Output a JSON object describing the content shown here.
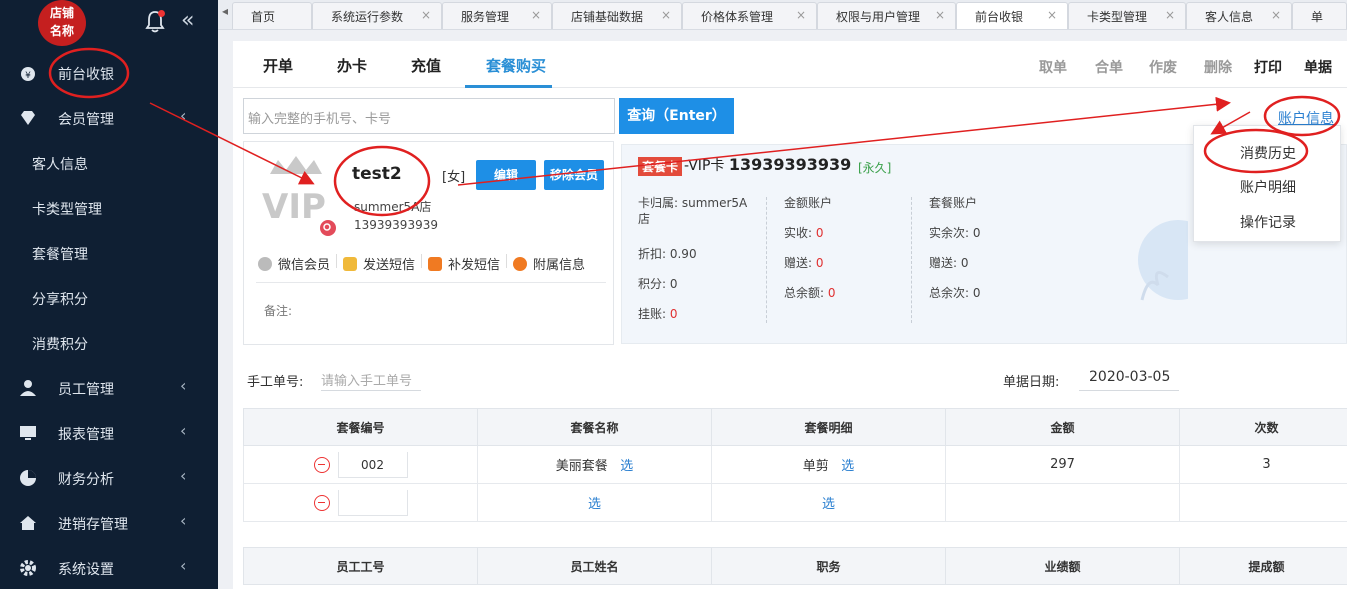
{
  "logo": {
    "line1": "店铺",
    "line2": "名称"
  },
  "sidebar": {
    "items": [
      {
        "label": "前台收银",
        "icon": "money-bag-icon"
      },
      {
        "label": "会员管理",
        "icon": "diamond-icon"
      },
      {
        "label": "客人信息"
      },
      {
        "label": "卡类型管理"
      },
      {
        "label": "套餐管理"
      },
      {
        "label": "分享积分"
      },
      {
        "label": "消费积分"
      },
      {
        "label": "员工管理",
        "icon": "user-icon"
      },
      {
        "label": "报表管理",
        "icon": "monitor-icon"
      },
      {
        "label": "财务分析",
        "icon": "pie-chart-icon"
      },
      {
        "label": "进销存管理",
        "icon": "home-icon"
      },
      {
        "label": "系统设置",
        "icon": "gear-icon"
      }
    ]
  },
  "tabs": [
    "首页",
    "系统运行参数",
    "服务管理",
    "店铺基础数据",
    "价格体系管理",
    "权限与用户管理",
    "前台收银",
    "卡类型管理",
    "客人信息",
    "单"
  ],
  "subtabs": [
    "开单",
    "办卡",
    "充值",
    "套餐购买"
  ],
  "actions": [
    "取单",
    "合单",
    "作废",
    "删除",
    "打印",
    "单据"
  ],
  "search": {
    "placeholder": "输入完整的手机号、卡号",
    "button": "查询（Enter）"
  },
  "account_link": "账户信息",
  "member": {
    "name": "test2",
    "gender": "[女]",
    "edit": "编辑",
    "remove": "移除会员",
    "store": "summer5A店",
    "phone": "13939393939",
    "links": [
      "微信会员",
      "发送短信",
      "补发短信",
      "附属信息"
    ],
    "note_label": "备注:"
  },
  "card": {
    "tag": "套餐卡",
    "title_prefix": "-VIP卡",
    "number": "13939393939",
    "validity": "[永久]",
    "col1": {
      "store": "卡归属: summer5A店",
      "discount": "折扣: 0.90",
      "points": "积分: 0",
      "debt_label": "挂账:",
      "debt": "0"
    },
    "col2": {
      "title": "金额账户",
      "paid_label": "实收:",
      "paid": "0",
      "gift_label": "赠送:",
      "gift": "0",
      "total_label": "总余额:",
      "total": "0"
    },
    "col3": {
      "title": "套餐账户",
      "paid": "实余次: 0",
      "gift": "赠送: 0",
      "total": "总余次: 0"
    }
  },
  "dropdown": [
    "消费历史",
    "账户明细",
    "操作记录"
  ],
  "form": {
    "manual_label": "手工单号:",
    "manual_placeholder": "请输入手工单号",
    "date_label": "单据日期:",
    "date_value": "2020-03-05"
  },
  "package_table": {
    "headers": [
      "套餐编号",
      "套餐名称",
      "套餐明细",
      "金额",
      "次数"
    ],
    "rows": [
      {
        "code": "002",
        "name": "美丽套餐",
        "pick": "选",
        "detail": "单剪",
        "pick2": "选",
        "amount": "297",
        "count": "3"
      },
      {
        "code": "",
        "name": "",
        "pick": "选",
        "detail": "",
        "pick2": "选",
        "amount": "",
        "count": ""
      }
    ]
  },
  "staff_table": {
    "headers": [
      "员工工号",
      "员工姓名",
      "职务",
      "业绩额",
      "提成额"
    ]
  }
}
